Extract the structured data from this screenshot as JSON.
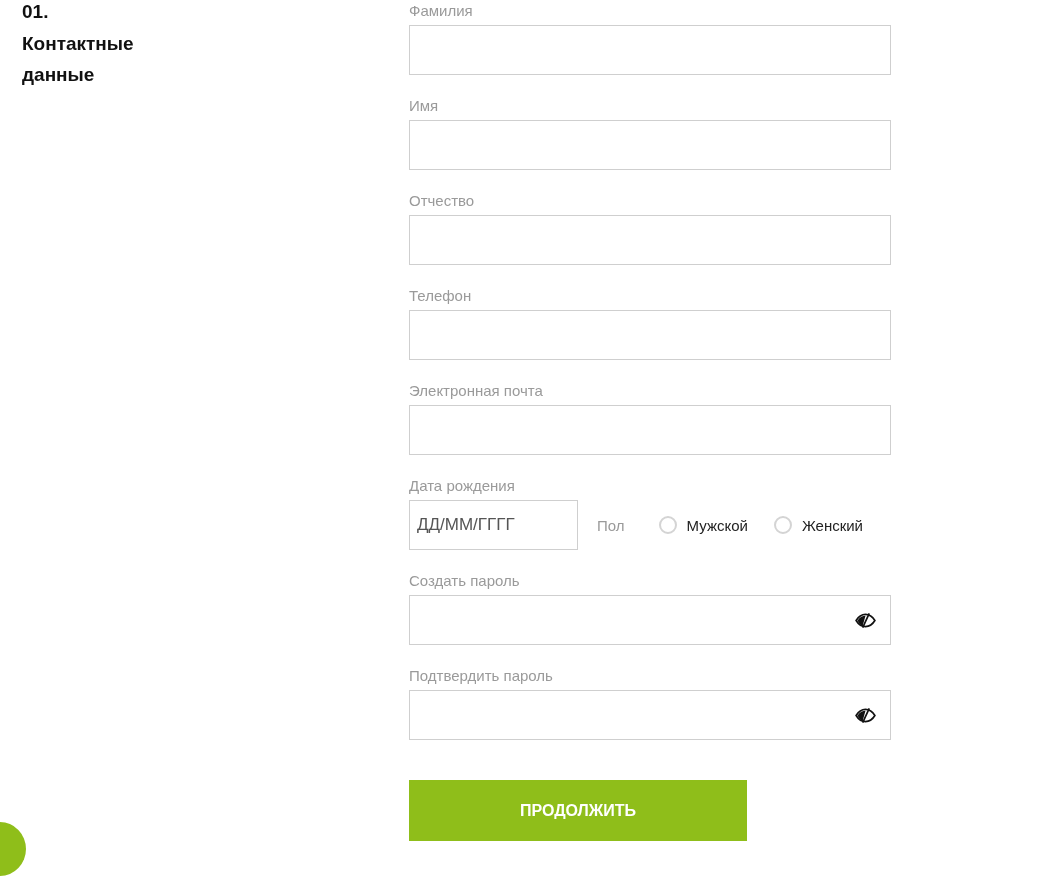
{
  "section": {
    "number": "01.",
    "title": "Контактные данные"
  },
  "fields": [
    {
      "kind": "text",
      "label": "Фамилия"
    },
    {
      "kind": "text",
      "label": "Имя"
    },
    {
      "kind": "text",
      "label": "Отчество"
    },
    {
      "kind": "text",
      "label": "Телефон"
    },
    {
      "kind": "text",
      "label": "Электронная почта"
    },
    {
      "kind": "date",
      "label": "Дата рождения",
      "placeholder": "ДД/ММ/ГГГГ",
      "gender": {
        "label": "Пол",
        "options": [
          {
            "label": "Мужской",
            "selected": false
          },
          {
            "label": "Женский",
            "selected": false
          }
        ]
      }
    },
    {
      "kind": "password",
      "label": "Создать пароль"
    },
    {
      "kind": "password",
      "label": "Подтвердить пароль"
    }
  ],
  "submit_button": "ПРОДОЛЖИТЬ"
}
